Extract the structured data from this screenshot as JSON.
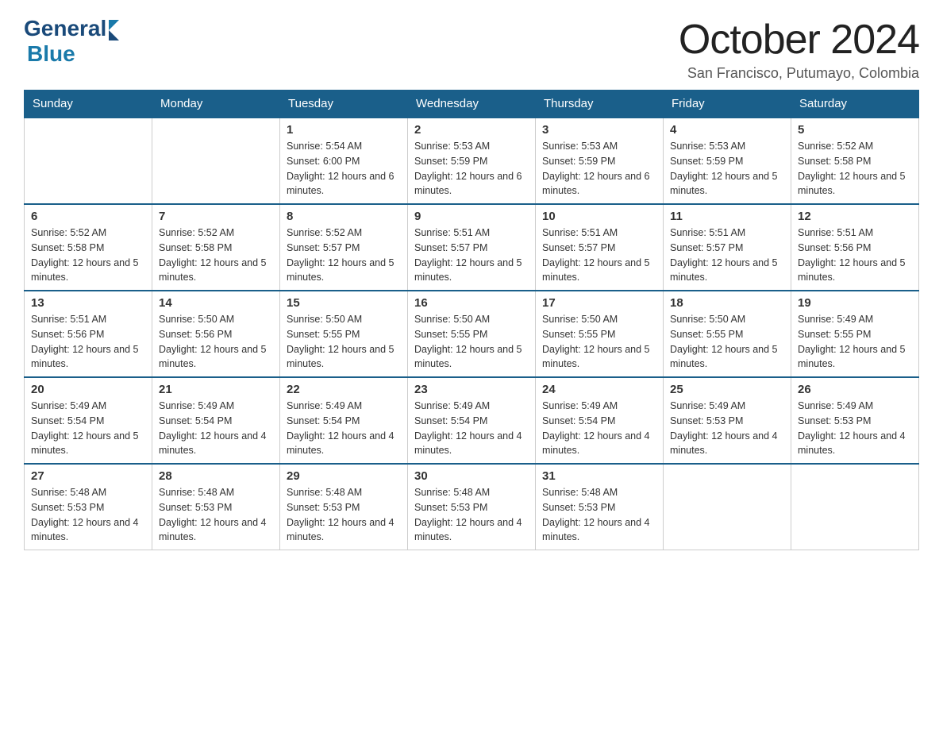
{
  "header": {
    "title": "October 2024",
    "subtitle": "San Francisco, Putumayo, Colombia",
    "logo_general": "General",
    "logo_blue": "Blue"
  },
  "days_of_week": [
    "Sunday",
    "Monday",
    "Tuesday",
    "Wednesday",
    "Thursday",
    "Friday",
    "Saturday"
  ],
  "weeks": [
    [
      {
        "day": "",
        "sunrise": "",
        "sunset": "",
        "daylight": ""
      },
      {
        "day": "",
        "sunrise": "",
        "sunset": "",
        "daylight": ""
      },
      {
        "day": "1",
        "sunrise": "Sunrise: 5:54 AM",
        "sunset": "Sunset: 6:00 PM",
        "daylight": "Daylight: 12 hours and 6 minutes."
      },
      {
        "day": "2",
        "sunrise": "Sunrise: 5:53 AM",
        "sunset": "Sunset: 5:59 PM",
        "daylight": "Daylight: 12 hours and 6 minutes."
      },
      {
        "day": "3",
        "sunrise": "Sunrise: 5:53 AM",
        "sunset": "Sunset: 5:59 PM",
        "daylight": "Daylight: 12 hours and 6 minutes."
      },
      {
        "day": "4",
        "sunrise": "Sunrise: 5:53 AM",
        "sunset": "Sunset: 5:59 PM",
        "daylight": "Daylight: 12 hours and 5 minutes."
      },
      {
        "day": "5",
        "sunrise": "Sunrise: 5:52 AM",
        "sunset": "Sunset: 5:58 PM",
        "daylight": "Daylight: 12 hours and 5 minutes."
      }
    ],
    [
      {
        "day": "6",
        "sunrise": "Sunrise: 5:52 AM",
        "sunset": "Sunset: 5:58 PM",
        "daylight": "Daylight: 12 hours and 5 minutes."
      },
      {
        "day": "7",
        "sunrise": "Sunrise: 5:52 AM",
        "sunset": "Sunset: 5:58 PM",
        "daylight": "Daylight: 12 hours and 5 minutes."
      },
      {
        "day": "8",
        "sunrise": "Sunrise: 5:52 AM",
        "sunset": "Sunset: 5:57 PM",
        "daylight": "Daylight: 12 hours and 5 minutes."
      },
      {
        "day": "9",
        "sunrise": "Sunrise: 5:51 AM",
        "sunset": "Sunset: 5:57 PM",
        "daylight": "Daylight: 12 hours and 5 minutes."
      },
      {
        "day": "10",
        "sunrise": "Sunrise: 5:51 AM",
        "sunset": "Sunset: 5:57 PM",
        "daylight": "Daylight: 12 hours and 5 minutes."
      },
      {
        "day": "11",
        "sunrise": "Sunrise: 5:51 AM",
        "sunset": "Sunset: 5:57 PM",
        "daylight": "Daylight: 12 hours and 5 minutes."
      },
      {
        "day": "12",
        "sunrise": "Sunrise: 5:51 AM",
        "sunset": "Sunset: 5:56 PM",
        "daylight": "Daylight: 12 hours and 5 minutes."
      }
    ],
    [
      {
        "day": "13",
        "sunrise": "Sunrise: 5:51 AM",
        "sunset": "Sunset: 5:56 PM",
        "daylight": "Daylight: 12 hours and 5 minutes."
      },
      {
        "day": "14",
        "sunrise": "Sunrise: 5:50 AM",
        "sunset": "Sunset: 5:56 PM",
        "daylight": "Daylight: 12 hours and 5 minutes."
      },
      {
        "day": "15",
        "sunrise": "Sunrise: 5:50 AM",
        "sunset": "Sunset: 5:55 PM",
        "daylight": "Daylight: 12 hours and 5 minutes."
      },
      {
        "day": "16",
        "sunrise": "Sunrise: 5:50 AM",
        "sunset": "Sunset: 5:55 PM",
        "daylight": "Daylight: 12 hours and 5 minutes."
      },
      {
        "day": "17",
        "sunrise": "Sunrise: 5:50 AM",
        "sunset": "Sunset: 5:55 PM",
        "daylight": "Daylight: 12 hours and 5 minutes."
      },
      {
        "day": "18",
        "sunrise": "Sunrise: 5:50 AM",
        "sunset": "Sunset: 5:55 PM",
        "daylight": "Daylight: 12 hours and 5 minutes."
      },
      {
        "day": "19",
        "sunrise": "Sunrise: 5:49 AM",
        "sunset": "Sunset: 5:55 PM",
        "daylight": "Daylight: 12 hours and 5 minutes."
      }
    ],
    [
      {
        "day": "20",
        "sunrise": "Sunrise: 5:49 AM",
        "sunset": "Sunset: 5:54 PM",
        "daylight": "Daylight: 12 hours and 5 minutes."
      },
      {
        "day": "21",
        "sunrise": "Sunrise: 5:49 AM",
        "sunset": "Sunset: 5:54 PM",
        "daylight": "Daylight: 12 hours and 4 minutes."
      },
      {
        "day": "22",
        "sunrise": "Sunrise: 5:49 AM",
        "sunset": "Sunset: 5:54 PM",
        "daylight": "Daylight: 12 hours and 4 minutes."
      },
      {
        "day": "23",
        "sunrise": "Sunrise: 5:49 AM",
        "sunset": "Sunset: 5:54 PM",
        "daylight": "Daylight: 12 hours and 4 minutes."
      },
      {
        "day": "24",
        "sunrise": "Sunrise: 5:49 AM",
        "sunset": "Sunset: 5:54 PM",
        "daylight": "Daylight: 12 hours and 4 minutes."
      },
      {
        "day": "25",
        "sunrise": "Sunrise: 5:49 AM",
        "sunset": "Sunset: 5:53 PM",
        "daylight": "Daylight: 12 hours and 4 minutes."
      },
      {
        "day": "26",
        "sunrise": "Sunrise: 5:49 AM",
        "sunset": "Sunset: 5:53 PM",
        "daylight": "Daylight: 12 hours and 4 minutes."
      }
    ],
    [
      {
        "day": "27",
        "sunrise": "Sunrise: 5:48 AM",
        "sunset": "Sunset: 5:53 PM",
        "daylight": "Daylight: 12 hours and 4 minutes."
      },
      {
        "day": "28",
        "sunrise": "Sunrise: 5:48 AM",
        "sunset": "Sunset: 5:53 PM",
        "daylight": "Daylight: 12 hours and 4 minutes."
      },
      {
        "day": "29",
        "sunrise": "Sunrise: 5:48 AM",
        "sunset": "Sunset: 5:53 PM",
        "daylight": "Daylight: 12 hours and 4 minutes."
      },
      {
        "day": "30",
        "sunrise": "Sunrise: 5:48 AM",
        "sunset": "Sunset: 5:53 PM",
        "daylight": "Daylight: 12 hours and 4 minutes."
      },
      {
        "day": "31",
        "sunrise": "Sunrise: 5:48 AM",
        "sunset": "Sunset: 5:53 PM",
        "daylight": "Daylight: 12 hours and 4 minutes."
      },
      {
        "day": "",
        "sunrise": "",
        "sunset": "",
        "daylight": ""
      },
      {
        "day": "",
        "sunrise": "",
        "sunset": "",
        "daylight": ""
      }
    ]
  ]
}
